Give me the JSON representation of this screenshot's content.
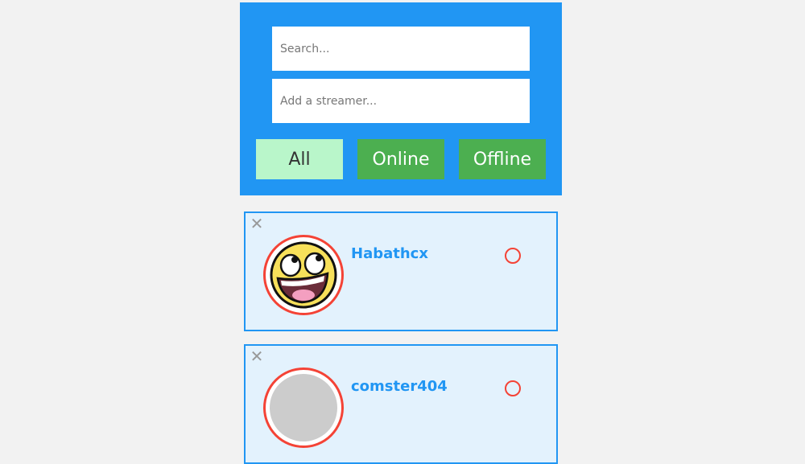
{
  "search": {
    "placeholder": "Search..."
  },
  "add_streamer": {
    "placeholder": "Add a streamer..."
  },
  "filters": [
    {
      "label": "All",
      "active": true
    },
    {
      "label": "Online",
      "active": false
    },
    {
      "label": "Offline",
      "active": false
    }
  ],
  "streamers": [
    {
      "name": "Habathcx",
      "status": "offline",
      "avatar": "awesome-face"
    },
    {
      "name": "comster404",
      "status": "offline",
      "avatar": "blank"
    }
  ],
  "icons": {
    "remove": "close-icon",
    "status": "status-ring-icon"
  },
  "colors": {
    "panel": "#2196f3",
    "filter_active": "#b9f6ca",
    "filter_inactive": "#4caf50",
    "card_bg": "#e3f2fd",
    "card_border": "#2196f3",
    "offline": "#f44336",
    "name": "#2196f3"
  }
}
